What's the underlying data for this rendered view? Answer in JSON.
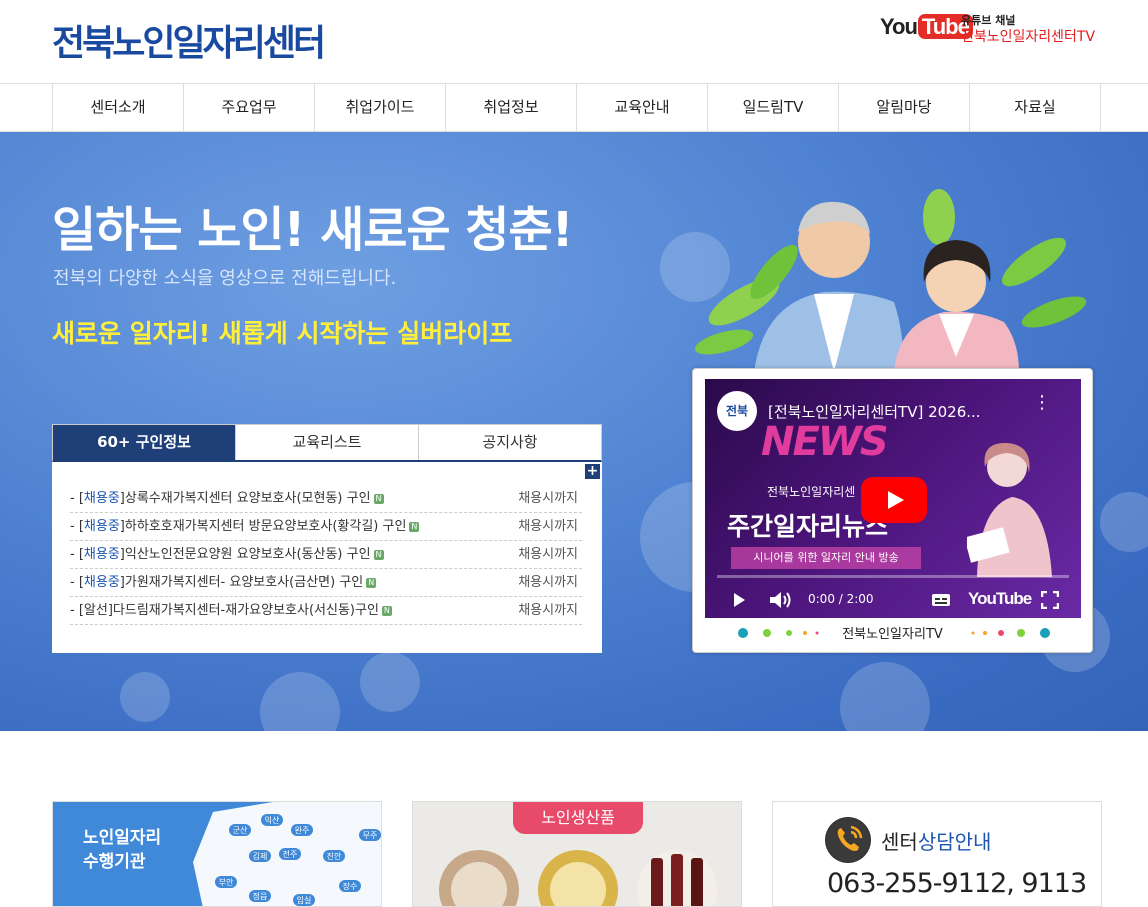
{
  "header": {
    "logo_part1": "전북",
    "logo_part2": "노인일자리센터",
    "youtube_logo_you": "You",
    "youtube_logo_tube": "Tube",
    "youtube_sub": "유튜브 채널",
    "youtube_channel": "전북노인일자리센터TV"
  },
  "nav": {
    "items": [
      "센터소개",
      "주요업무",
      "취업가이드",
      "취업정보",
      "교육안내",
      "일드림TV",
      "알림마당",
      "자료실"
    ]
  },
  "hero": {
    "title": "일하는 노인! 새로운 청춘!",
    "subtitle": "전북의 다양한 소식을 영상으로 전해드립니다.",
    "slogan": "새로운 일자리! 새롭게 시작하는 실버라이프"
  },
  "jobs": {
    "tabs": [
      "60+ 구인정보",
      "교육리스트",
      "공지사항"
    ],
    "more": "+",
    "items": [
      {
        "status": "채용중",
        "text": "상록수재가복지센터 요양보호사(모현동) 구인",
        "date": "채용시까지"
      },
      {
        "status": "채용중",
        "text": "하하호호재가복지센터 방문요양보호사(황각길) 구인",
        "date": "채용시까지"
      },
      {
        "status": "채용중",
        "text": "익산노인전문요양원 요양보호사(동산동) 구인",
        "date": "채용시까지"
      },
      {
        "status": "채용중",
        "text": "가원재가복지센터- 요양보호사(금산면) 구인",
        "date": "채용시까지"
      },
      {
        "status": "알선",
        "text": "다드림재가복지센터-재가요양보호사(서신동)구인",
        "date": "채용시까지"
      }
    ],
    "new_badge": "N"
  },
  "video": {
    "channel_badge": "전북",
    "title": "[전북노인일자리센터TV] 2026...",
    "news": "NEWS",
    "mid_text": "전북노인일자리센",
    "big_text": "주간일자리뉴스",
    "tag": "시니어를 위한 일자리 안내 방송",
    "time": "0:00 / 2:00",
    "yt_logo": "YouTube",
    "caption": "전북노인일자리TV",
    "progress": 0.0
  },
  "cards": {
    "card1_title_line1": "노인일자리",
    "card1_title_line2": "수행기관",
    "regions": [
      "군산",
      "익산",
      "완주",
      "무주",
      "김제",
      "전주",
      "진안",
      "부안",
      "정읍",
      "장수",
      "임실"
    ],
    "card2_badge": "노인생산품",
    "card3_title_plain": "센터",
    "card3_title_blue": "상담안내",
    "card3_phone": "063-255-9112, 9113"
  },
  "colors": {
    "brand_blue": "#1a4aa0",
    "nav_active": "#1e3f78",
    "hero_yellow": "#ffef3a",
    "youtube_red": "#e52d27"
  }
}
